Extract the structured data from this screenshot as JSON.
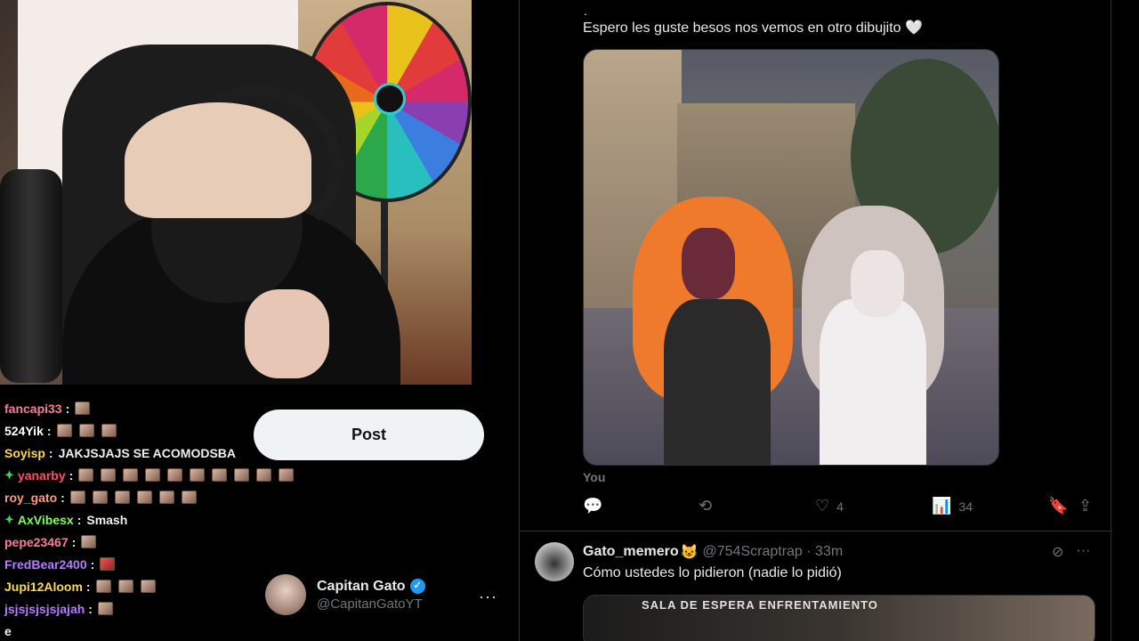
{
  "stream": {
    "chat": [
      {
        "user": "fancapi33",
        "color": "#ff7a9a",
        "badge": "",
        "message": "",
        "emotes": 1,
        "emote_style": "normal"
      },
      {
        "user": "524Yik",
        "color": "#ffffff",
        "badge": "",
        "message": "",
        "emotes": 3,
        "emote_style": "normal"
      },
      {
        "user": "Soyisp",
        "color": "#ffd84d",
        "badge": "",
        "message": "JAKJSJAJS SE ACOMODSBA",
        "emotes": 0,
        "emote_style": "normal"
      },
      {
        "user": "yanarby",
        "color": "#ff4d6a",
        "badge": "✦",
        "message": "",
        "emotes": 10,
        "emote_style": "normal"
      },
      {
        "user": "roy_gato",
        "color": "#ff9a7a",
        "badge": "",
        "message": "",
        "emotes": 6,
        "emote_style": "normal"
      },
      {
        "user": "AxVibesx",
        "color": "#7fff5a",
        "badge": "✦",
        "message": "Smash",
        "emotes": 0,
        "emote_style": "normal"
      },
      {
        "user": "pepe23467",
        "color": "#ff7a9a",
        "badge": "",
        "message": "",
        "emotes": 1,
        "emote_style": "normal"
      },
      {
        "user": "FredBear2400",
        "color": "#b57aff",
        "badge": "",
        "message": "",
        "emotes": 1,
        "emote_style": "red"
      },
      {
        "user": "Jupi12Aloom",
        "color": "#ffd84d",
        "badge": "",
        "message": "",
        "emotes": 3,
        "emote_style": "normal"
      },
      {
        "user": "jsjsjsjsjsjajah",
        "color": "#b57aff",
        "badge": "",
        "message": "",
        "emotes": 1,
        "emote_style": "normal"
      }
    ],
    "cut_off_line": "e"
  },
  "overlay": {
    "post_label": "Post",
    "profile_name": "Capitan Gato",
    "profile_handle": "@CapitanGatoYT",
    "more": "···"
  },
  "feed": {
    "tweet1": {
      "dot": ".",
      "text": "Espero les guste besos nos vemos en otro dibujito 🤍",
      "caption": "You",
      "reply_count": "",
      "repost_count": "",
      "like_count": "4",
      "views_count": "34"
    },
    "tweet2": {
      "name": "Gato_memero",
      "emoji": "😺",
      "handle": "@754Scraptrap · 33m",
      "text": "Cómo ustedes lo pidieron (nadie lo pidió)",
      "media_label": "SALA DE ESPERA ENFRENTAMIENTO"
    }
  },
  "icons": {
    "reply": "💬",
    "repost": "⟲",
    "like": "♡",
    "views": "📊",
    "bookmark": "🔖",
    "share": "⇪",
    "verified": "✓"
  }
}
